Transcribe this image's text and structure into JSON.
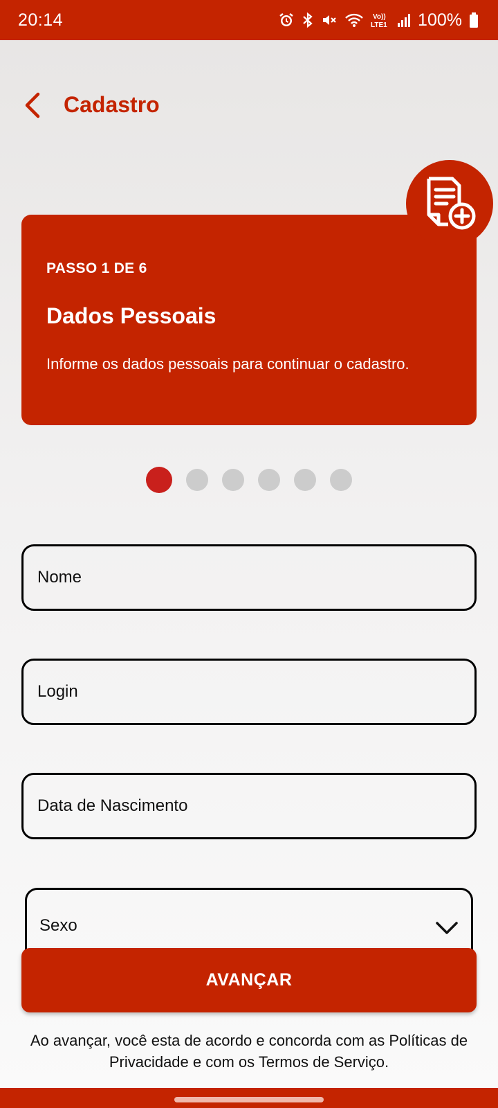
{
  "status_bar": {
    "time": "20:14",
    "battery": "100%",
    "icons": [
      "alarm-icon",
      "bluetooth-icon",
      "mute-icon",
      "wifi-icon",
      "volte-icon",
      "signal-icon",
      "battery-icon"
    ],
    "volte_label": "Vo)) LTE1"
  },
  "header": {
    "title": "Cadastro",
    "back_icon": "chevron-left-icon"
  },
  "step_card": {
    "step_label": "PASSO 1 DE 6",
    "title": "Dados Pessoais",
    "description": "Informe os dados pessoais para continuar o cadastro.",
    "badge_icon": "document-add-icon"
  },
  "progress": {
    "current_step": 1,
    "total_steps": 6
  },
  "form": {
    "name_placeholder": "Nome",
    "login_placeholder": "Login",
    "birthdate_placeholder": "Data de Nascimento",
    "sex_placeholder": "Sexo"
  },
  "actions": {
    "advance_label": "AVANÇAR"
  },
  "footer": {
    "terms_text": "Ao avançar, você esta de acordo e concorda com as Políticas de Privacidade e com os Termos de Serviço."
  },
  "colors": {
    "brand": "#c42400",
    "active_dot": "#c9201c",
    "inactive_dot": "#cccccc"
  }
}
